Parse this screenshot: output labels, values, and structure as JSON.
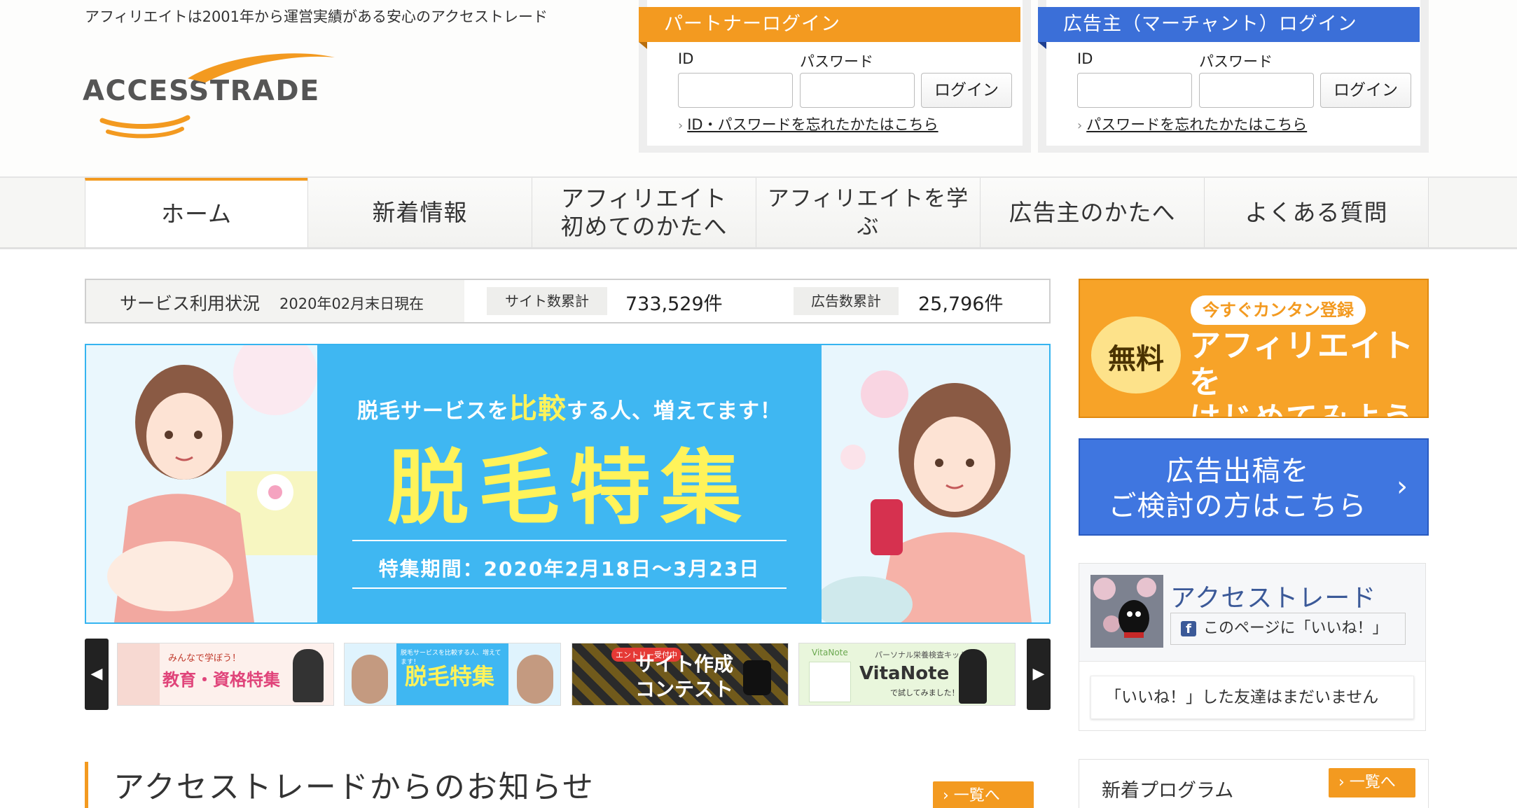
{
  "header": {
    "tagline": "アフィリエイトは2001年から運営実績がある安心のアクセストレード",
    "logo_text": "ACCESSTRADE"
  },
  "partner_login": {
    "title": "パートナーログイン",
    "id_label": "ID",
    "password_label": "パスワード",
    "button": "ログイン",
    "forgot_link": "ID・パスワードを忘れたかたはこちら"
  },
  "merchant_login": {
    "title": "広告主（マーチャント）ログイン",
    "id_label": "ID",
    "password_label": "パスワード",
    "button": "ログイン",
    "forgot_link": "パスワードを忘れたかたはこちら"
  },
  "nav": {
    "home": "ホーム",
    "news": "新着情報",
    "beginner_line1": "アフィリエイト",
    "beginner_line2": "初めてのかたへ",
    "learn": "アフィリエイトを学ぶ",
    "advertiser": "広告主のかたへ",
    "faq": "よくある質問"
  },
  "stats": {
    "title": "サービス利用状況",
    "as_of": "2020年02月末日現在",
    "sites_label": "サイト数累計",
    "sites_value": "733,529件",
    "ads_label": "広告数累計",
    "ads_value": "25,796件"
  },
  "banner": {
    "subtitle_pre": "脱毛サービスを",
    "subtitle_big": "比較",
    "subtitle_post": "する人、増えてます！",
    "title": "脱毛特集",
    "period": "特集期間：2020年2月18日〜3月23日"
  },
  "thumbs": {
    "t1_small": "みんなで学ぼう！",
    "t1_title": "教育・資格特集",
    "t2_small": "脱毛サービスを比較する人、増えてます！",
    "t2_title": "脱毛特集",
    "t3_tag": "エントリー受付中",
    "t3_title1": "サイト作成",
    "t3_title2": "コンテスト",
    "t4_brand": "VitaNote",
    "t4_sub": "パーソナル栄養検査キット",
    "t4_title": "VitaNote",
    "t4_text": "で試してみました！"
  },
  "news_section": {
    "title": "アクセストレードからのお知らせ",
    "more": "一覧へ"
  },
  "sidebar": {
    "signup_pill": "今すぐカンタン登録",
    "signup_free": "無料",
    "signup_line1": "アフィリエイトを",
    "signup_line2": "はじめてみよう",
    "advertiser_line1": "広告出稿を",
    "advertiser_line2": "ご検討の方はこちら",
    "fb_name": "アクセストレード",
    "fb_like": "このページに「いいね！」",
    "fb_friends": "「いいね！」した友達はまだいません",
    "new_programs_title": "新着プログラム",
    "new_programs_more": "一覧へ"
  },
  "colors": {
    "orange": "#f39a20",
    "blue": "#3b6fd8",
    "banner_blue": "#3fb7f2",
    "banner_yellow": "#fff35a",
    "facebook": "#3b5998"
  }
}
